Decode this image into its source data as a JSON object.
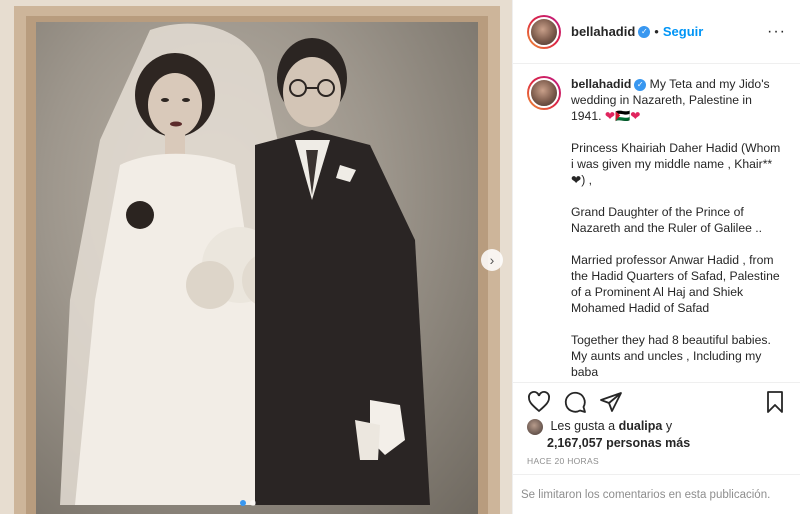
{
  "post": {
    "username": "bellahadid",
    "follow_label": "Seguir",
    "separator": "•",
    "more_label": "···",
    "verified_glyph": "✓",
    "caption": {
      "line1": "My Teta and my Jido's wedding in Nazareth, Palestine in 1941.",
      "emoji": "❤🇵🇸❤",
      "p1": "Princess Khairiah Daher Hadid (Whom i was given my middle name , Khair**❤) ,",
      "p2": "Grand Daughter of the Prince of Nazareth and the Ruler of Galilee ..",
      "p3": "Married professor Anwar Hadid , from the Hadid Quarters of Safad, Palestine of a Prominent Al Haj and Shiek Mohamed Hadid of Safad",
      "p4": "Together they had 8 beautiful babies. My aunts and uncles , Including my baba"
    },
    "likes": {
      "prefix": "Les gusta a",
      "liker": "dualipa",
      "conjunction": "y",
      "count_text": "2,167,057 personas más"
    },
    "timestamp": "HACE 20 HORAS",
    "comments_disabled": "Se limitaron los comentarios en esta publicación."
  },
  "media": {
    "next_glyph": "›",
    "photo_description_icon": "wedding-photo"
  },
  "colors": {
    "accent": "#0095f6",
    "verified": "#3897f0",
    "muted": "#8e8e8e",
    "border": "#efefef"
  }
}
